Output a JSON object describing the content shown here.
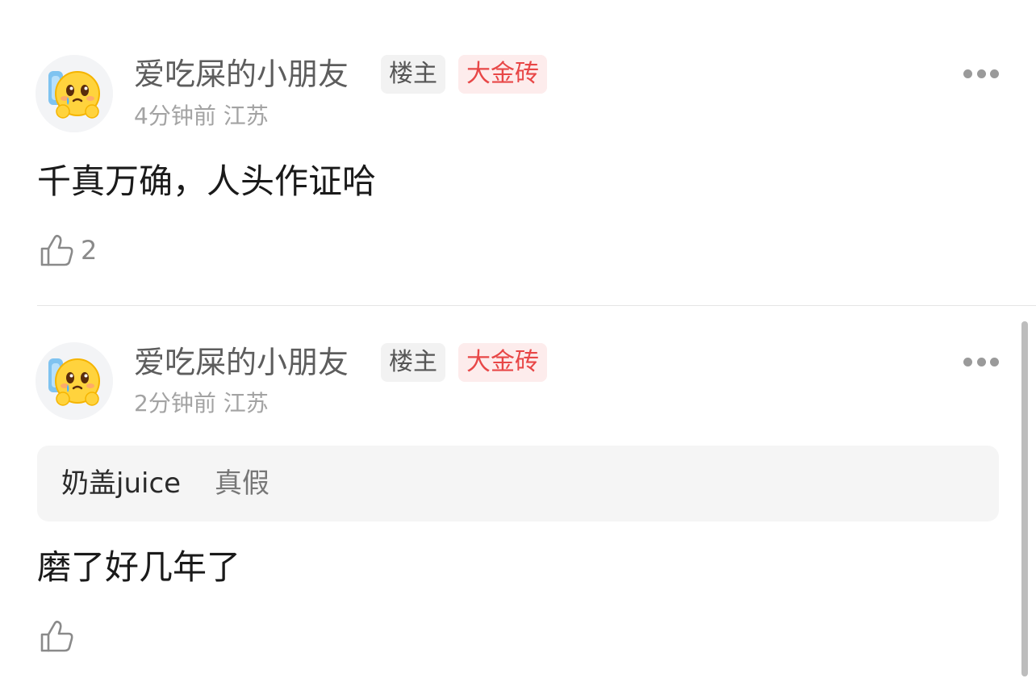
{
  "comments": [
    {
      "username": "爱吃屎的小朋友",
      "badge_host": "楼主",
      "badge_level": "大金砖",
      "time": "4分钟前",
      "location": "江苏",
      "body": "千真万确，人头作证哈",
      "like_count": "2",
      "avatar_icon": "crying-emoji-avatar",
      "more_icon": "more-dots-icon"
    },
    {
      "username": "爱吃屎的小朋友",
      "badge_host": "楼主",
      "badge_level": "大金砖",
      "time": "2分钟前",
      "location": "江苏",
      "quote": {
        "user": "奶盖juice",
        "text": "真假"
      },
      "body": "磨了好几年了",
      "like_count": "",
      "avatar_icon": "crying-emoji-avatar",
      "more_icon": "more-dots-icon"
    }
  ],
  "colors": {
    "username": "#5d5d5d",
    "meta": "#a3a3a3",
    "badge_level_text": "#e84747",
    "badge_level_bg": "#fdecec",
    "body": "#1a1a1a"
  }
}
